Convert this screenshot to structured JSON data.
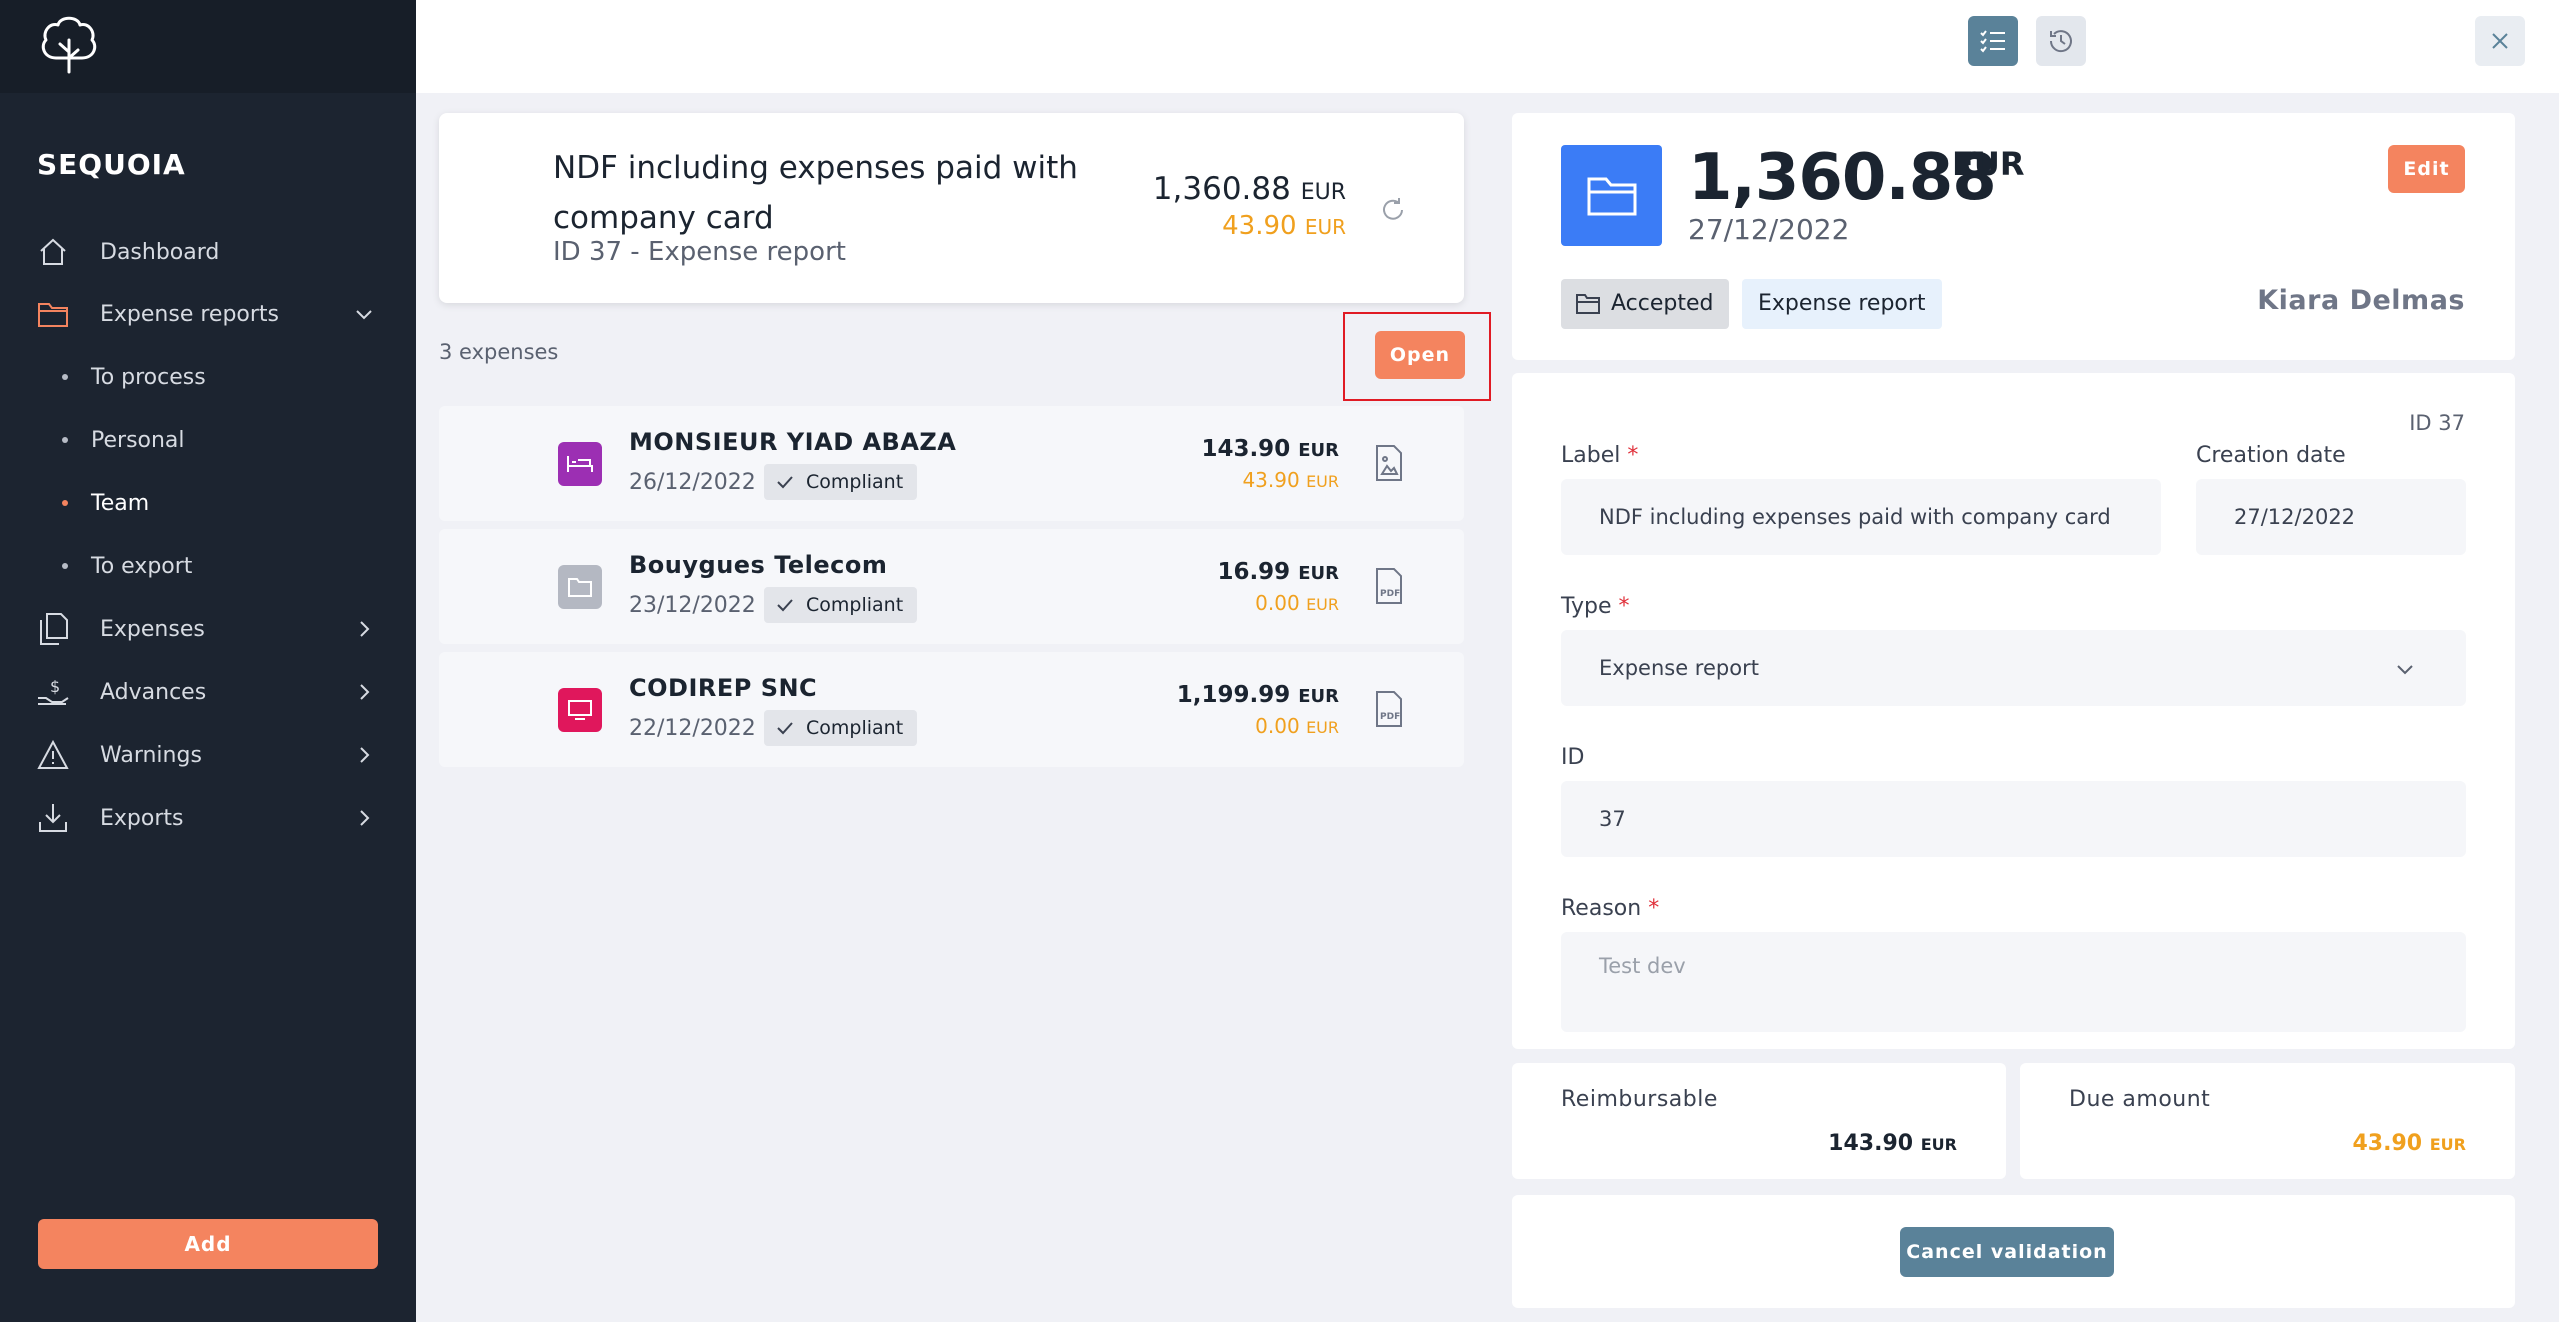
{
  "sidebar": {
    "brand": "SEQUOIA",
    "items": [
      {
        "label": "Dashboard",
        "icon": "home-icon"
      },
      {
        "label": "Expense reports",
        "icon": "folder-icon"
      },
      {
        "label": "Expenses",
        "icon": "receipt-icon"
      },
      {
        "label": "Advances",
        "icon": "hand-coin-icon"
      },
      {
        "label": "Warnings",
        "icon": "warning-icon"
      },
      {
        "label": "Exports",
        "icon": "download-icon"
      }
    ],
    "sub_items": [
      {
        "label": "To process"
      },
      {
        "label": "Personal"
      },
      {
        "label": "Team",
        "active": true
      },
      {
        "label": "To export"
      }
    ],
    "add_label": "Add"
  },
  "colors": {
    "accent": "#f4845f",
    "sidebar_bg": "#1c2430",
    "due": "#f0a01e",
    "primary_blue": "#3b7cf6",
    "slate": "#5a8299"
  },
  "report": {
    "title": "NDF including expenses paid with company card",
    "subtitle": "ID 37 - Expense report",
    "amount": "1,360.88",
    "currency": "EUR",
    "due": "43.90",
    "expenses_count": "3 expenses",
    "open_label": "Open"
  },
  "expenses": [
    {
      "name": "MONSIEUR YIAD ABAZA",
      "date": "26/12/2022",
      "status": "Compliant",
      "amount": "143.90",
      "due": "43.90",
      "currency": "EUR",
      "icon_color": "#9c2fb3",
      "icon": "bed-icon",
      "doc_icon": "image-file-icon"
    },
    {
      "name": "Bouygues Telecom",
      "date": "23/12/2022",
      "status": "Compliant",
      "amount": "16.99",
      "due": "0.00",
      "currency": "EUR",
      "icon_color": "#b4b8c2",
      "icon": "folder-icon",
      "doc_icon": "pdf-file-icon"
    },
    {
      "name": "CODIREP SNC",
      "date": "22/12/2022",
      "status": "Compliant",
      "amount": "1,199.99",
      "due": "0.00",
      "currency": "EUR",
      "icon_color": "#e0175c",
      "icon": "monitor-icon",
      "doc_icon": "pdf-file-icon"
    }
  ],
  "detail": {
    "amount": "1,360.88",
    "currency": "EUR",
    "date": "27/12/2022",
    "edit_label": "Edit",
    "status": "Accepted",
    "type_chip": "Expense report",
    "user": "Kiara Delmas",
    "id_label": "ID 37",
    "form": {
      "label_label": "Label",
      "label_value": "NDF including expenses paid with company card",
      "creation_label": "Creation date",
      "creation_value": "27/12/2022",
      "type_label": "Type",
      "type_value": "Expense report",
      "id_label": "ID",
      "id_value": "37",
      "reason_label": "Reason",
      "reason_placeholder": "Test dev",
      "required_mark": "*"
    },
    "reimbursable_label": "Reimbursable",
    "reimbursable_value": "143.90",
    "due_label": "Due amount",
    "due_value": "43.90",
    "cancel_label": "Cancel validation"
  }
}
